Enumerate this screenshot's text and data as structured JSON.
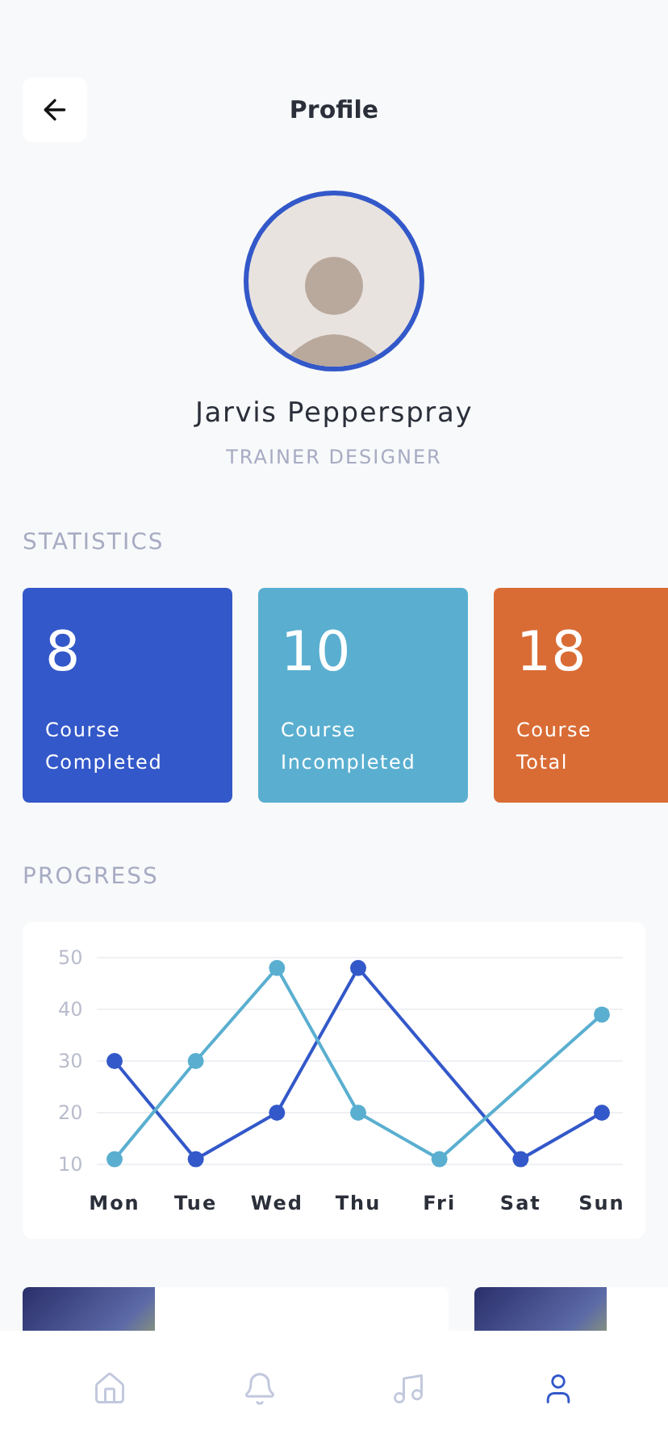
{
  "header": {
    "title": "Profile"
  },
  "profile": {
    "name": "Jarvis Pepperspray",
    "role": "TRAINER DESIGNER"
  },
  "statistics": {
    "heading": "STATISTICS",
    "cards": [
      {
        "value": "8",
        "label": "Course Completed",
        "color": "#3358c9"
      },
      {
        "value": "10",
        "label": "Course Incompleted",
        "color": "#5aafd0"
      },
      {
        "value": "18",
        "label": "Course Total",
        "color": "#d96c35"
      }
    ]
  },
  "progress": {
    "heading": "PROGRESS",
    "chart_data": {
      "type": "line",
      "grid": true,
      "categories": [
        "Mon",
        "Tue",
        "Wed",
        "Thu",
        "Fri",
        "Sat",
        "Sun"
      ],
      "ylim": [
        10,
        50
      ],
      "yticks": [
        10,
        20,
        30,
        40,
        50
      ],
      "series": [
        {
          "color": "#3358c9",
          "marker": true,
          "values": [
            30,
            11,
            20,
            48,
            null,
            11,
            20
          ]
        },
        {
          "color": "#5aafd0",
          "marker": true,
          "values": [
            11,
            30,
            48,
            20,
            11,
            null,
            39
          ]
        }
      ]
    }
  },
  "courses": [
    {
      "kind": "course"
    },
    {
      "kind": "course"
    }
  ],
  "nav": [
    {
      "kind": "home",
      "selected": false
    },
    {
      "kind": "bell",
      "selected": false
    },
    {
      "kind": "music",
      "selected": false
    },
    {
      "kind": "user",
      "selected": true
    }
  ]
}
